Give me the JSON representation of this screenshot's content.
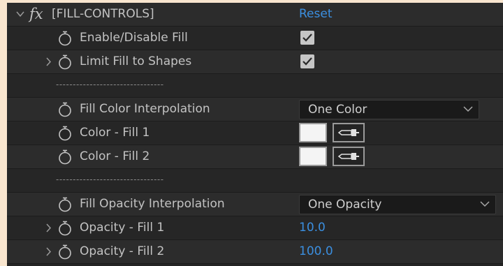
{
  "effect": {
    "fx_glyph": "fx",
    "name": "[FILL-CONTROLS]",
    "reset_label": "Reset"
  },
  "rows": {
    "enable": {
      "label": "Enable/Disable Fill",
      "checked": true
    },
    "limit": {
      "label": "Limit Fill to Shapes",
      "checked": true
    },
    "separator1": "--------------------------------",
    "color_interp": {
      "label": "Fill Color Interpolation",
      "value": "One Color"
    },
    "color1": {
      "label": "Color - Fill 1",
      "swatch_color": "#f4f4f4"
    },
    "color2": {
      "label": "Color - Fill 2",
      "swatch_color": "#f4f4f4"
    },
    "separator2": "--------------------------------",
    "opacity_interp": {
      "label": "Fill Opacity Interpolation",
      "value": "One Opacity"
    },
    "opacity1": {
      "label": "Opacity - Fill 1",
      "value": "10.0"
    },
    "opacity2": {
      "label": "Opacity - Fill 2",
      "value": "100.0"
    }
  },
  "colors": {
    "panel_bg": "#242424",
    "row_alt_bg": "#2c2c2c",
    "label_text": "#c3c3c3",
    "value_blue": "#3b8fe0",
    "outer_bg": "#f9e6cf"
  },
  "icons": [
    "twirl-down-icon",
    "fx-icon",
    "stopwatch-icon",
    "twirl-right-icon",
    "checkmark-icon",
    "chevron-down-icon",
    "eyedropper-icon"
  ]
}
